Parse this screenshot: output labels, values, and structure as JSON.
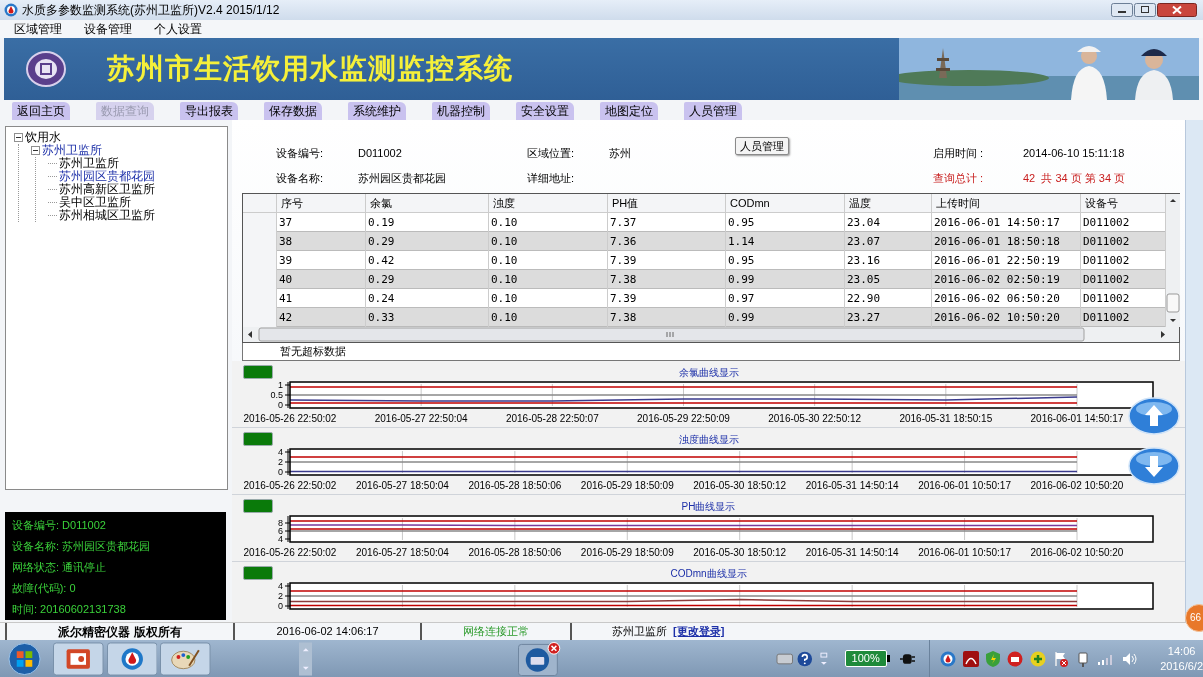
{
  "window": {
    "title": "水质多参数监测系统(苏州卫监所)V2.4 2015/1/12"
  },
  "menu": [
    "区域管理",
    "设备管理",
    "个人设置"
  ],
  "banner": {
    "title": "苏州市生活饮用水监测监控系统"
  },
  "tabs": [
    {
      "label": "返回主页",
      "disabled": false
    },
    {
      "label": "数据查询",
      "disabled": true
    },
    {
      "label": "导出报表",
      "disabled": false
    },
    {
      "label": "保存数据",
      "disabled": false
    },
    {
      "label": "系统维护",
      "disabled": false
    },
    {
      "label": "机器控制",
      "disabled": false
    },
    {
      "label": "安全设置",
      "disabled": false
    },
    {
      "label": "地图定位",
      "disabled": false
    },
    {
      "label": "人员管理",
      "disabled": false
    }
  ],
  "tooltip": "人员管理",
  "tree": [
    {
      "label": "饮用水",
      "expanded": true,
      "selected": false,
      "children": [
        {
          "label": "苏州卫监所",
          "expanded": true,
          "selected": true,
          "children": [
            {
              "label": "苏州卫监所",
              "selected": false
            },
            {
              "label": "苏州园区贵都花园",
              "selected": true
            },
            {
              "label": "苏州高新区卫监所",
              "selected": false
            },
            {
              "label": "吴中区卫监所",
              "selected": false
            },
            {
              "label": "苏州相城区卫监所",
              "selected": false
            }
          ]
        }
      ]
    }
  ],
  "device_status": [
    "设备编号: D011002",
    "设备名称: 苏州园区贵都花园",
    "网络状态: 通讯停止",
    "故障(代码): 0",
    "时间: 20160602131738"
  ],
  "info": [
    {
      "kind": "normal",
      "label": "设备编号:",
      "value": "D011002"
    },
    {
      "kind": "normal",
      "label": "区域位置:",
      "value": "苏州"
    },
    {
      "kind": "normal",
      "label": "启用时间 :",
      "value": "2014-06-10 15:11:18"
    },
    {
      "kind": "normal",
      "label": "设备名称:",
      "value": "苏州园区贵都花园"
    },
    {
      "kind": "normal",
      "label": "详细地址:"
    },
    {
      "kind": "alert",
      "label": "查询总计 :",
      "value": "42  共 34 页 第 34 页"
    }
  ],
  "table": {
    "columns": [
      "序号",
      "余氯",
      "浊度",
      "PH值",
      "CODmn",
      "温度",
      "上传时间",
      "设备号"
    ],
    "rows": [
      [
        "37",
        "0.19",
        "0.10",
        "7.37",
        "0.95",
        "23.04",
        "2016-06-01 14:50:17",
        "D011002"
      ],
      [
        "38",
        "0.29",
        "0.10",
        "7.36",
        "1.14",
        "23.07",
        "2016-06-01 18:50:18",
        "D011002"
      ],
      [
        "39",
        "0.42",
        "0.10",
        "7.39",
        "0.95",
        "23.16",
        "2016-06-01 22:50:19",
        "D011002"
      ],
      [
        "40",
        "0.29",
        "0.10",
        "7.38",
        "0.99",
        "23.05",
        "2016-06-02 02:50:19",
        "D011002"
      ],
      [
        "41",
        "0.24",
        "0.10",
        "7.39",
        "0.97",
        "22.90",
        "2016-06-02 06:50:20",
        "D011002"
      ],
      [
        "42",
        "0.33",
        "0.10",
        "7.38",
        "0.99",
        "23.27",
        "2016-06-02 10:50:20",
        "D011002"
      ]
    ]
  },
  "notice": "暂无超标数据",
  "charts": [
    {
      "title": "余氯曲线显示",
      "chart_data": {
        "type": "line",
        "x": [
          "2016-05-26 22:50:02",
          "2016-05-27 22:50:04",
          "2016-05-28 22:50:07",
          "2016-05-29 22:50:09",
          "2016-05-30 22:50:12",
          "2016-05-31 18:50:15",
          "2016-06-01 14:50:17"
        ],
        "ylim": [
          0,
          1
        ],
        "yticks": [
          0,
          0.5,
          1
        ],
        "grid": true,
        "series": [
          {
            "color": "#888888",
            "values": [
              0.5,
              0.5,
              0.5,
              0.5,
              0.5,
              0.5,
              0.5
            ]
          },
          {
            "color": "#c00000",
            "values": [
              0.9,
              0.9,
              0.9,
              0.9,
              0.9,
              0.9,
              0.9
            ]
          },
          {
            "color": "#c00000",
            "values": [
              0.1,
              0.1,
              0.1,
              0.1,
              0.1,
              0.1,
              0.1
            ]
          },
          {
            "color": "#3a3a8c",
            "values": [
              0.25,
              0.2,
              0.2,
              0.3,
              0.3,
              0.25,
              0.4
            ]
          }
        ]
      }
    },
    {
      "title": "浊度曲线显示",
      "chart_data": {
        "type": "line",
        "x": [
          "2016-05-26 22:50:02",
          "2016-05-27 18:50:04",
          "2016-05-28 18:50:06",
          "2016-05-29 18:50:09",
          "2016-05-30 18:50:12",
          "2016-05-31 14:50:14",
          "2016-06-01 10:50:17",
          "2016-06-02 10:50:20"
        ],
        "ylim": [
          0,
          4
        ],
        "yticks": [
          0,
          2,
          4
        ],
        "grid": true,
        "series": [
          {
            "color": "#888888",
            "values": [
              2,
              2,
              2,
              2,
              2,
              2,
              2,
              2
            ]
          },
          {
            "color": "#c00000",
            "values": [
              3,
              3,
              3,
              3,
              3,
              3,
              3,
              3
            ]
          },
          {
            "color": "#3a3a8c",
            "values": [
              0.1,
              0.1,
              0.1,
              0.1,
              0.1,
              0.1,
              0.1,
              0.1
            ]
          }
        ]
      }
    },
    {
      "title": "PH曲线显示",
      "chart_data": {
        "type": "line",
        "x": [
          "2016-05-26 22:50:02",
          "2016-05-27 18:50:04",
          "2016-05-28 18:50:06",
          "2016-05-29 18:50:09",
          "2016-05-30 18:50:12",
          "2016-05-31 14:50:14",
          "2016-06-01 10:50:17",
          "2016-06-02 10:50:20"
        ],
        "ylim": [
          4,
          9
        ],
        "yticks": [
          4,
          6,
          8
        ],
        "grid": true,
        "series": [
          {
            "color": "#888888",
            "values": [
              6,
              6,
              6,
              6,
              6,
              6,
              6,
              6
            ]
          },
          {
            "color": "#c00000",
            "values": [
              8.5,
              8.5,
              8.5,
              8.5,
              8.5,
              8.5,
              8.5,
              8.5
            ]
          },
          {
            "color": "#c00000",
            "values": [
              6.5,
              6.5,
              6.5,
              6.5,
              6.5,
              6.5,
              6.5,
              6.5
            ]
          },
          {
            "color": "#7a3a9c",
            "values": [
              7.5,
              7.5,
              7.4,
              7.4,
              7.4,
              7.4,
              7.4,
              7.4
            ]
          }
        ]
      }
    },
    {
      "title": "CODmn曲线显示",
      "chart_data": {
        "type": "line",
        "ylim": [
          0,
          4
        ],
        "yticks": [
          0,
          2,
          4
        ],
        "grid": true,
        "series": [
          {
            "color": "#888888",
            "values": [
              2,
              2,
              2,
              2,
              2,
              2,
              2,
              2
            ]
          },
          {
            "color": "#c00000",
            "values": [
              3,
              3,
              3,
              3,
              3,
              3,
              3,
              3
            ]
          },
          {
            "color": "#c00000",
            "values": [
              0.1,
              0.1,
              0.1,
              0.1,
              0.1,
              0.1,
              0.1,
              0.1
            ]
          },
          {
            "color": "#8c3a3a",
            "values": [
              0.9,
              0.9,
              0.9,
              0.9,
              1.3,
              0.9,
              0.9,
              0.9
            ]
          }
        ]
      }
    }
  ],
  "badge": "66",
  "status_bar": {
    "copyright": "派尔精密仪器 版权所有",
    "datetime": "2016-06-02 14:06:17",
    "network": "网络连接正常",
    "user": "苏州卫监所",
    "link": "[更改登录]"
  },
  "taskbar": {
    "battery": "100%",
    "clock_time": "14:06",
    "clock_date": "2016/6/2"
  }
}
